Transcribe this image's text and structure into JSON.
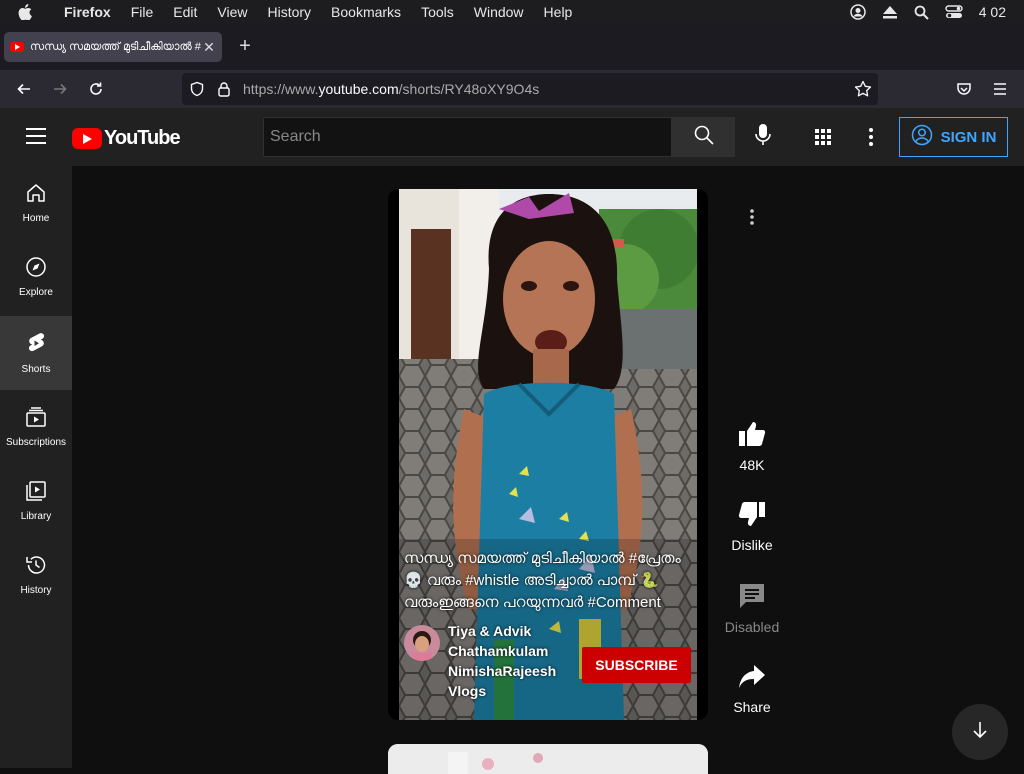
{
  "menubar": {
    "app": "Firefox",
    "items": [
      "File",
      "Edit",
      "View",
      "History",
      "Bookmarks",
      "Tools",
      "Window",
      "Help"
    ],
    "clock": "4 02"
  },
  "browser": {
    "tab_title": "സന്ധ്യ സമയത്ത് മുടിചീകിയാൽ #",
    "url_prefix": "https://www.",
    "url_domain": "youtube.com",
    "url_path": "/shorts/RY48oXY9O4s"
  },
  "youtube": {
    "logo_text": "YouTube",
    "search_placeholder": "Search",
    "sign_in_label": "SIGN IN",
    "sidebar": [
      {
        "label": "Home",
        "icon": "home-icon"
      },
      {
        "label": "Explore",
        "icon": "compass-icon"
      },
      {
        "label": "Shorts",
        "icon": "shorts-icon",
        "active": true
      },
      {
        "label": "Subscriptions",
        "icon": "subscriptions-icon"
      },
      {
        "label": "Library",
        "icon": "library-icon"
      },
      {
        "label": "History",
        "icon": "history-icon"
      }
    ],
    "short": {
      "caption_line1": "സന്ധ്യ സമയത്ത് മുടിചീകിയാൽ #പ്രേതം",
      "caption_line2": "💀 വരും #whistle അടിച്ചാൽ പാമ്പ് 🐍",
      "caption_line3": "വരുംഇങ്ങനെ പറയുന്നവർ #Comment",
      "channel_name": "Tiya & Advik Chathamkulam NimishaRajeesh Vlogs",
      "subscribe_label": "SUBSCRIBE"
    },
    "actions": {
      "like_count": "48K",
      "dislike_label": "Dislike",
      "comments_label": "Disabled",
      "share_label": "Share"
    }
  }
}
